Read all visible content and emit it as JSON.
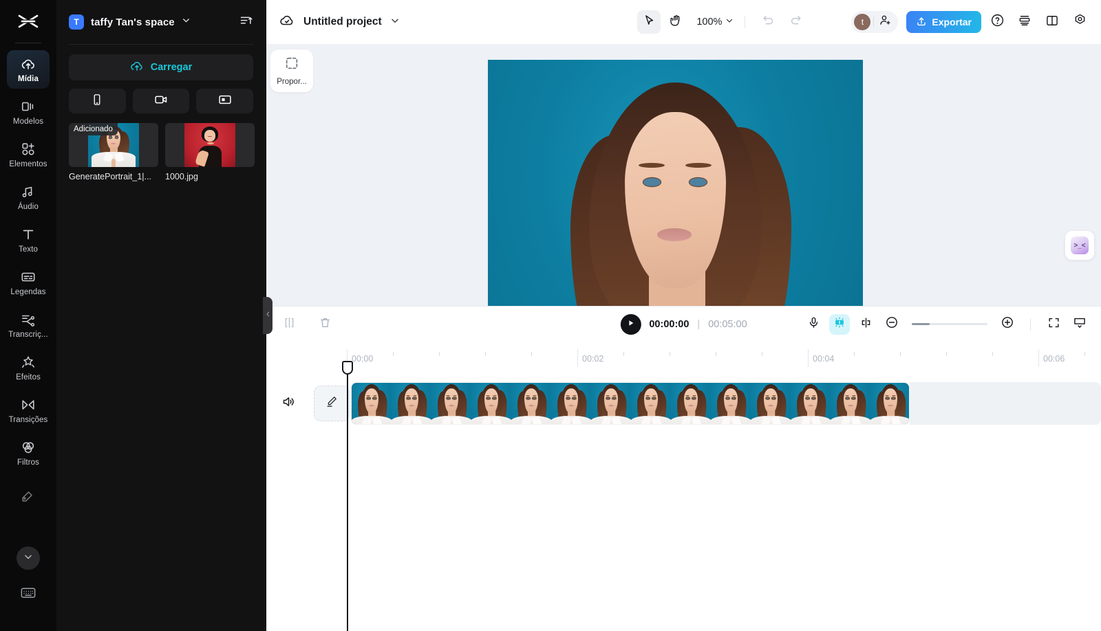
{
  "app": {
    "name": "CapCut Web Editor",
    "logo_icon": "capcut-logo-icon"
  },
  "rail": {
    "items": [
      {
        "label": "Mídia",
        "icon": "cloud-upload-icon",
        "active": true
      },
      {
        "label": "Modelos",
        "icon": "templates-icon",
        "active": false
      },
      {
        "label": "Elementos",
        "icon": "elements-icon",
        "active": false
      },
      {
        "label": "Áudio",
        "icon": "audio-note-icon",
        "active": false
      },
      {
        "label": "Texto",
        "icon": "text-t-icon",
        "active": false
      },
      {
        "label": "Legendas",
        "icon": "captions-icon",
        "active": false
      },
      {
        "label": "Transcriç...",
        "icon": "transcription-icon",
        "active": false
      },
      {
        "label": "Efeitos",
        "icon": "effects-sparkle-icon",
        "active": false
      },
      {
        "label": "Transições",
        "icon": "transitions-icon",
        "active": false
      },
      {
        "label": "Filtros",
        "icon": "filters-icon",
        "active": false
      }
    ],
    "more_icon": "chevron-down-icon",
    "keyboard_icon": "keyboard-icon",
    "adjust_icon": "adjust-icon"
  },
  "panel": {
    "space_initial": "T",
    "space_name": "taffy Tan's space",
    "space_chevron_icon": "chevron-down-icon",
    "sort_icon": "sort-ascending-icon",
    "upload_label": "Carregar",
    "upload_icon": "cloud-upload-icon",
    "source_buttons": [
      {
        "icon": "phone-icon",
        "name": "import-from-phone"
      },
      {
        "icon": "camera-icon",
        "name": "record-video"
      },
      {
        "icon": "screen-icon",
        "name": "record-screen"
      }
    ],
    "media": [
      {
        "label": "GeneratePortrait_1|...",
        "badge": "Adicionado"
      },
      {
        "label": "1000.jpg",
        "badge": ""
      }
    ],
    "collapse_icon": "chevron-left-icon"
  },
  "topbar": {
    "cloud_icon": "cloud-check-icon",
    "project_name": "Untitled project",
    "project_chevron_icon": "chevron-down-icon",
    "select_tool_icon": "cursor-arrow-icon",
    "hand_tool_icon": "hand-icon",
    "zoom_level": "100%",
    "zoom_chevron_icon": "chevron-down-icon",
    "undo_icon": "undo-icon",
    "redo_icon": "redo-icon",
    "avatar_initial": "t",
    "invite_icon": "add-user-icon",
    "export_label": "Exportar",
    "export_icon": "upload-share-icon",
    "help_icon": "question-circle-icon",
    "layers_icon": "layers-icon",
    "layout_icon": "split-layout-icon",
    "settings_icon": "settings-gear-icon"
  },
  "canvas": {
    "aspect_label": "Propor...",
    "aspect_icon": "crop-dashed-icon",
    "ai_assistant_face": ">_<"
  },
  "timeline": {
    "split_icon": "split-clip-icon",
    "delete_icon": "trash-icon",
    "play_icon": "play-icon",
    "current_time": "00:00:00",
    "time_separator": "|",
    "total_time": "00:05:00",
    "mic_icon": "microphone-icon",
    "autocut_icon": "auto-cut-icon",
    "split-marker_icon": "split-marker-icon",
    "zoom_out_icon": "zoom-out-icon",
    "zoom_in_icon": "zoom-in-icon",
    "fit_icon": "fit-screen-icon",
    "monitor_icon": "monitor-icon",
    "zoom_slider_value": 22,
    "ruler_labels": [
      "00:00",
      "00:02",
      "00:04",
      "00:06"
    ],
    "track": {
      "volume_icon": "speaker-icon",
      "edit_icon": "pencil-edit-icon",
      "clip_frames": 14
    }
  },
  "colors": {
    "accent_teal": "#18c8d8",
    "accent_blue": "#3a7afe",
    "export_gradient_from": "#3b82f6",
    "export_gradient_to": "#22b8e6",
    "panel_bg": "#121213",
    "rail_bg": "#0a0a0b",
    "canvas_bg": "#eef1f5",
    "stage_bg": "#0d7ea1",
    "playhead": "#16181c"
  }
}
